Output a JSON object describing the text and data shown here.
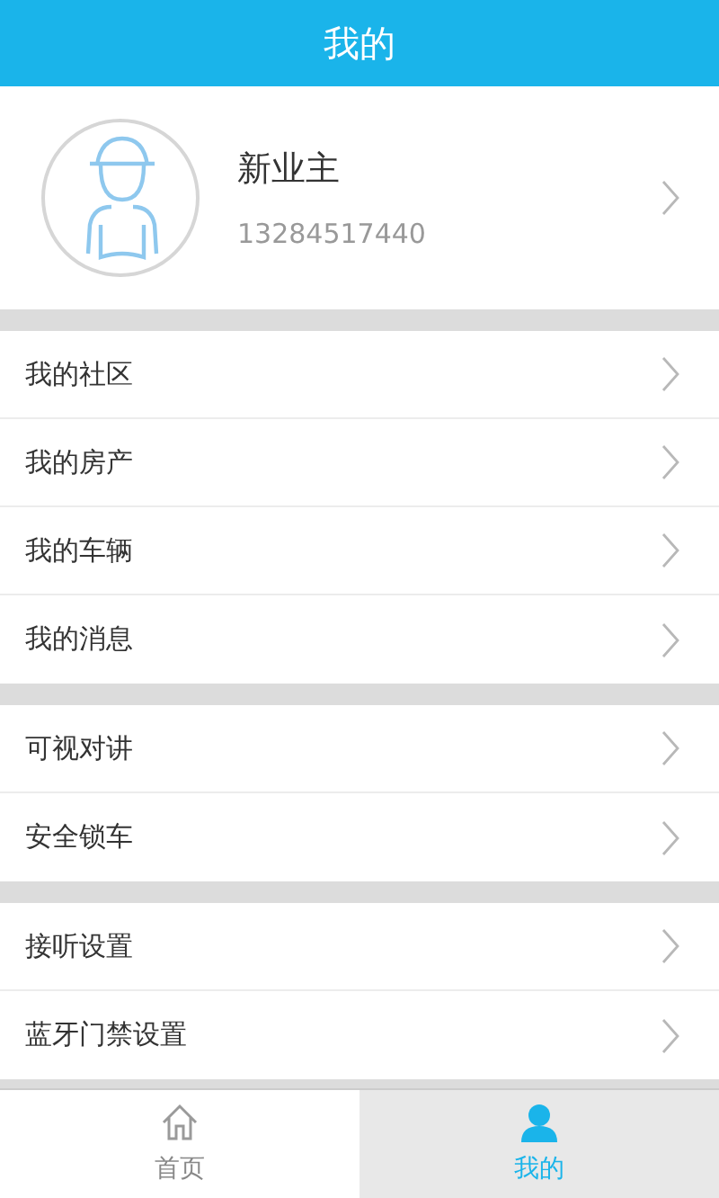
{
  "header": {
    "title": "我的"
  },
  "profile": {
    "name": "新业主",
    "phone": "13284517440"
  },
  "sections": [
    {
      "items": [
        {
          "label": "我的社区"
        },
        {
          "label": "我的房产"
        },
        {
          "label": "我的车辆"
        },
        {
          "label": "我的消息"
        }
      ]
    },
    {
      "items": [
        {
          "label": "可视对讲"
        },
        {
          "label": "安全锁车"
        }
      ]
    },
    {
      "items": [
        {
          "label": "接听设置"
        },
        {
          "label": "蓝牙门禁设置"
        }
      ]
    }
  ],
  "tabs": [
    {
      "label": "首页",
      "kind": "home",
      "selected": false
    },
    {
      "label": "我的",
      "kind": "person",
      "selected": true
    }
  ]
}
